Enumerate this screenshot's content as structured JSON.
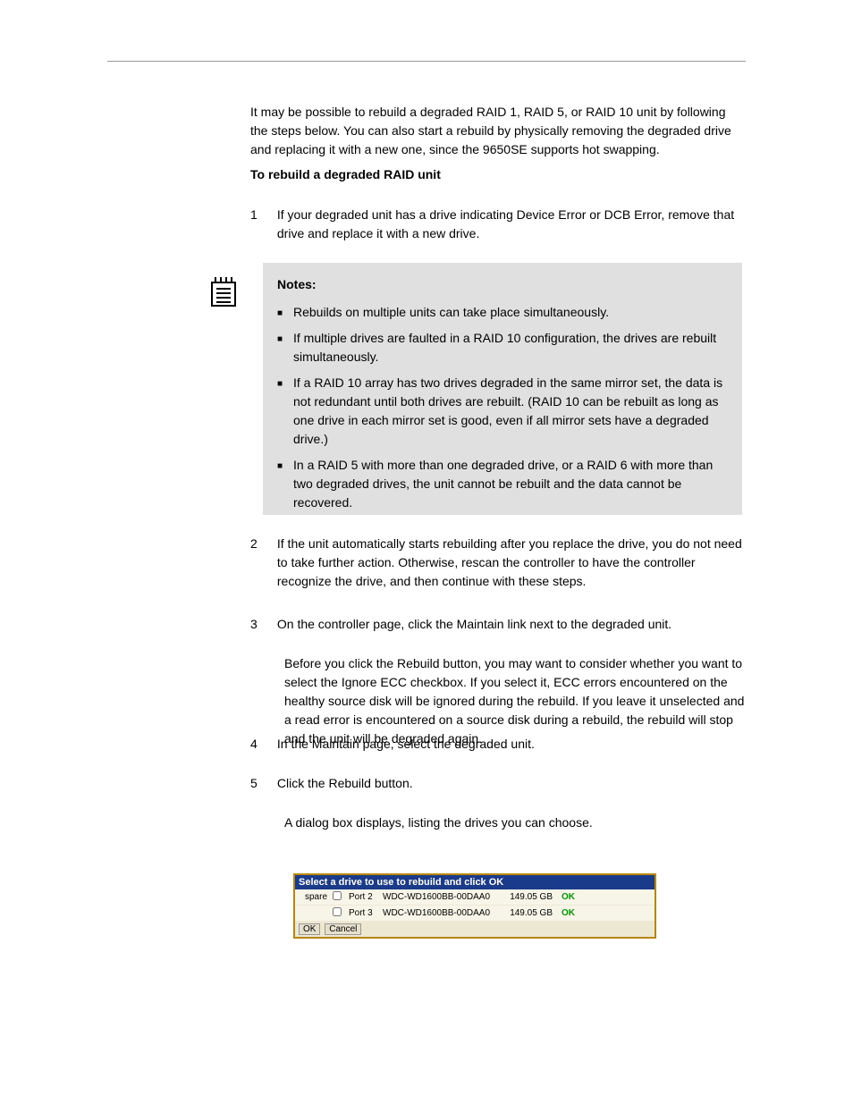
{
  "paragraphs": {
    "p1": "It may be possible to rebuild a degraded RAID 1, RAID 5, or RAID 10 unit by following the steps below. You can also start a rebuild by physically removing the degraded drive and replacing it with a new one, since the 9650SE supports hot swapping.",
    "p2": "To rebuild a degraded RAID unit",
    "p3": "Before you click the Rebuild button, you may want to consider whether you want to select the Ignore ECC checkbox. If you select it, ECC errors encountered on the healthy source disk will be ignored during the rebuild. If you leave it unselected and a read error is encountered on a source disk during a rebuild, the rebuild will stop and the unit will be degraded again.",
    "p4": "A dialog box displays, listing the drives you can choose."
  },
  "list": {
    "n1": {
      "num": "1",
      "text": "If your degraded unit has a drive indicating Device Error or DCB Error, remove that drive and replace it with a new drive."
    },
    "n2": {
      "num": "2",
      "text": "If the unit automatically starts rebuilding after you replace the drive, you do not need to take further action. Otherwise, rescan the controller to have the controller recognize the drive, and then continue with these steps."
    },
    "n3": {
      "num": "3",
      "text": "On the controller page, click the Maintain link next to the degraded unit."
    },
    "n4": {
      "num": "4",
      "text": "In the Maintain page, select the degraded unit."
    },
    "n5": {
      "num": "5",
      "text": "Click the Rebuild button."
    }
  },
  "note": {
    "lead": "Notes:",
    "b1": "Rebuilds on multiple units can take place simultaneously.",
    "b2": "If multiple drives are faulted in a RAID 10 configuration, the drives are rebuilt simultaneously.",
    "b3": "If a RAID 10 array has two drives degraded in the same mirror set, the data is not redundant until both drives are rebuilt. (RAID 10 can be rebuilt as long as one drive in each mirror set is good, even if all mirror sets have a degraded drive.)",
    "b4": "In a RAID 5 with more than one degraded drive, or a RAID 6 with more than two degraded drives, the unit cannot be rebuilt and the data cannot be recovered."
  },
  "dialog": {
    "title": "Select a drive to use to rebuild and click OK",
    "rows": [
      {
        "spare": "spare",
        "port": "Port 2",
        "model": "WDC-WD1600BB-00DAA0",
        "size": "149.05 GB",
        "status": "OK"
      },
      {
        "spare": "",
        "port": "Port 3",
        "model": "WDC-WD1600BB-00DAA0",
        "size": "149.05 GB",
        "status": "OK"
      }
    ],
    "ok": "OK",
    "cancel": "Cancel"
  }
}
